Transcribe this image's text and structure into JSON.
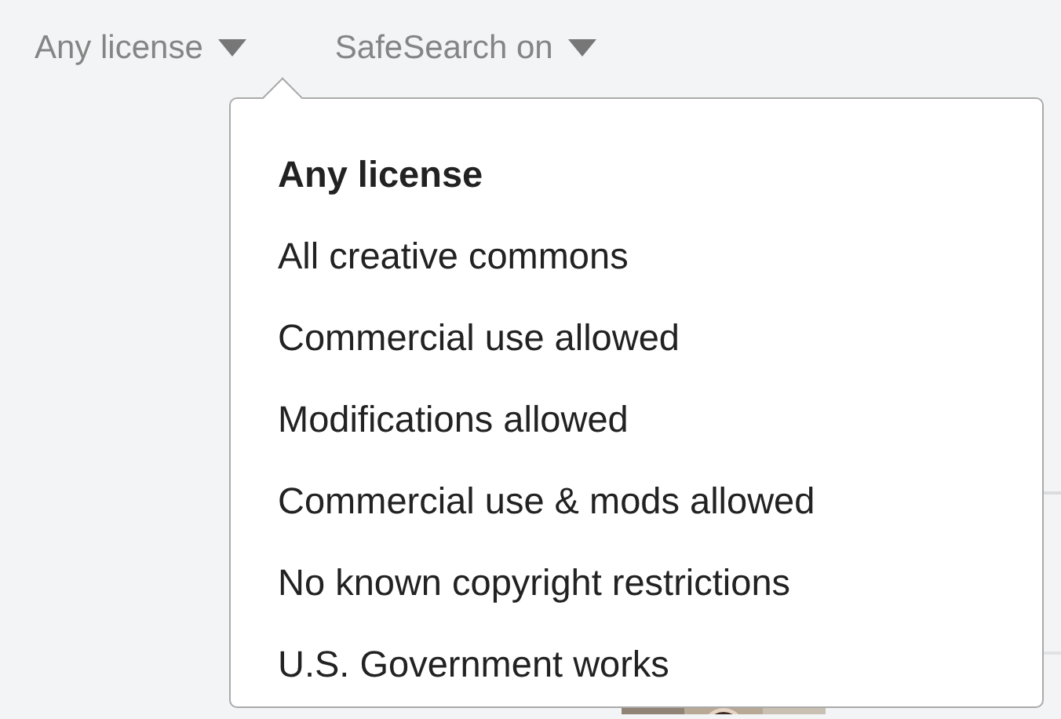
{
  "filters": [
    {
      "label": "Any license"
    },
    {
      "label": "SafeSearch on"
    }
  ],
  "license_menu": {
    "items": [
      {
        "label": "Any license",
        "selected": true
      },
      {
        "label": "All creative commons",
        "selected": false
      },
      {
        "label": "Commercial use allowed",
        "selected": false
      },
      {
        "label": "Modifications allowed",
        "selected": false
      },
      {
        "label": "Commercial use & mods allowed",
        "selected": false
      },
      {
        "label": "No known copyright restrictions",
        "selected": false
      },
      {
        "label": "U.S. Government works",
        "selected": false
      }
    ]
  }
}
